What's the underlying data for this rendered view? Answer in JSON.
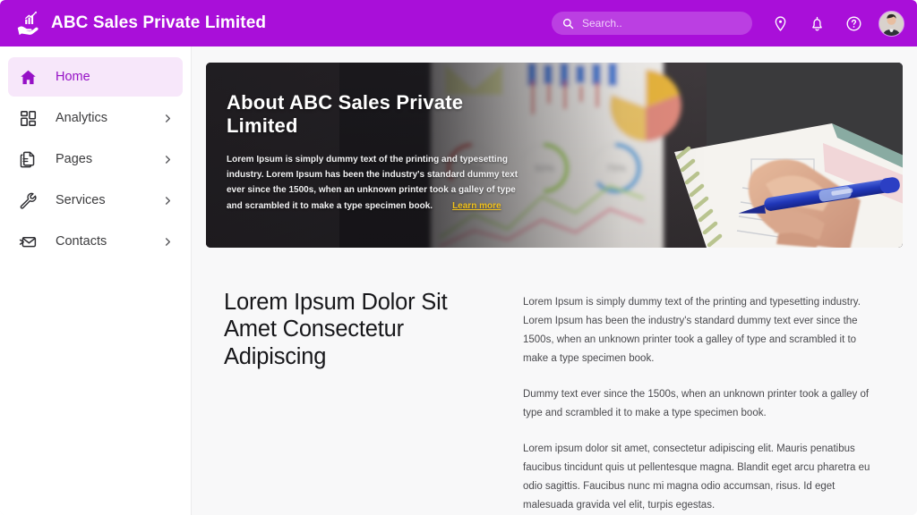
{
  "header": {
    "brand_name": "ABC Sales Private Limited",
    "logo_icon": "hand-holding-growth-chart-icon",
    "search": {
      "placeholder": "Search..",
      "value": "",
      "icon": "search-icon"
    },
    "icons": [
      {
        "name": "location-pin-icon",
        "label": "Location"
      },
      {
        "name": "bell-icon",
        "label": "Notifications"
      },
      {
        "name": "help-circle-icon",
        "label": "Help"
      }
    ],
    "avatar": {
      "name": "user-avatar",
      "label": "User profile"
    },
    "accent_color": "#A90FD9",
    "search_pill_color": "#BB3FE2"
  },
  "sidebar": {
    "items": [
      {
        "label": "Home",
        "icon": "home-icon",
        "active": true,
        "has_chevron": false
      },
      {
        "label": "Analytics",
        "icon": "dashboard-grid-icon",
        "active": false,
        "has_chevron": true
      },
      {
        "label": "Pages",
        "icon": "document-pages-icon",
        "active": false,
        "has_chevron": true
      },
      {
        "label": "Services",
        "icon": "wrench-icon",
        "active": false,
        "has_chevron": true
      },
      {
        "label": "Contacts",
        "icon": "envelope-contacts-icon",
        "active": false,
        "has_chevron": true
      }
    ],
    "active_bg_color": "#F7E7FA",
    "active_text_color": "#9611C6"
  },
  "hero": {
    "title": "About ABC Sales Private Limited",
    "paragraph": "Lorem Ipsum is simply dummy text of the printing and typesetting industry. Lorem Ipsum has been the industry's standard dummy text ever since the 1500s, when an unknown printer took a galley of type and scrambled it to make a type specimen book.",
    "link_label": "Learn more",
    "link_color": "#F2C21B",
    "image_description": "Hand holding a blue pen writing in a spiral notebook beside a printed analytics report with donut charts"
  },
  "article": {
    "title": "Lorem Ipsum Dolor Sit Amet Consectetur Adipiscing",
    "paragraphs": [
      "Lorem Ipsum is simply dummy text of the printing and typesetting industry. Lorem Ipsum has been the industry's standard dummy text ever since the 1500s, when an unknown printer took a galley of type and scrambled it to make a type specimen book.",
      "Dummy text ever since the 1500s, when an unknown printer took a galley of type and scrambled it to make a type specimen book.",
      "Lorem ipsum dolor sit amet, consectetur adipiscing elit. Mauris penatibus faucibus tincidunt quis ut pellentesque magna. Blandit eget arcu pharetra eu odio sagittis. Faucibus nunc mi magna odio accumsan, risus. Id eget malesuada gravida vel elit, turpis egestas."
    ]
  }
}
